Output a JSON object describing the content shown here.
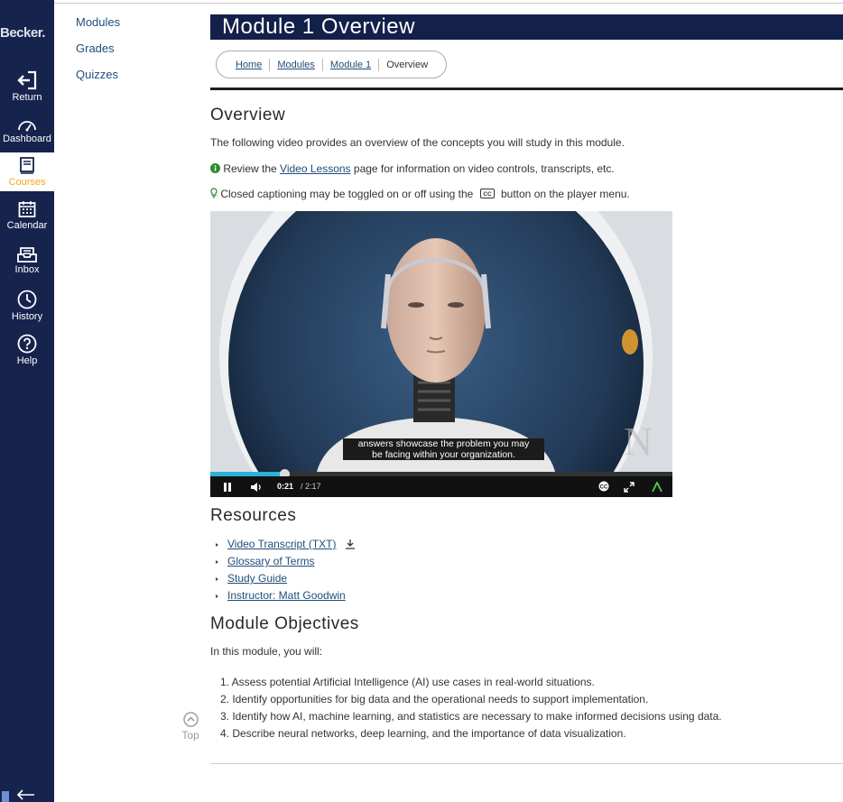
{
  "global_nav": {
    "logo": "Becker.",
    "items": [
      {
        "label": "Return",
        "icon": "return-icon"
      },
      {
        "label": "Dashboard",
        "icon": "dashboard-icon"
      },
      {
        "label": "Courses",
        "icon": "courses-icon",
        "active": true
      },
      {
        "label": "Calendar",
        "icon": "calendar-icon"
      },
      {
        "label": "Inbox",
        "icon": "inbox-icon"
      },
      {
        "label": "History",
        "icon": "history-icon"
      },
      {
        "label": "Help",
        "icon": "help-icon"
      }
    ]
  },
  "course_nav": {
    "items": [
      "Modules",
      "Grades",
      "Quizzes"
    ]
  },
  "header": {
    "title": "Module 1 Overview"
  },
  "breadcrumb": {
    "home": "Home",
    "modules": "Modules",
    "module1": "Module 1",
    "current": "Overview"
  },
  "overview": {
    "heading": "Overview",
    "intro": "The following video provides an overview of the concepts you will study in this module.",
    "review_pre": "Review the ",
    "review_link": "Video Lessons",
    "review_post": " page for information on video controls, transcripts, etc.",
    "cc_pre": "Closed captioning may be toggled on or off using the ",
    "cc_post": " button on the player menu."
  },
  "video": {
    "caption_line1": "answers showcase the problem you may",
    "caption_line2": "be facing within your organization.",
    "current_time": "0:21",
    "duration": "/ 2:17",
    "progress": 0.16,
    "watermark": "N"
  },
  "resources": {
    "heading": "Resources",
    "items": [
      "Video Transcript (TXT)",
      "Glossary of Terms",
      "Study Guide",
      "Instructor: Matt Goodwin"
    ]
  },
  "objectives": {
    "heading": "Module Objectives",
    "intro": "In this module, you will:",
    "items": [
      "1. Assess potential Artificial Intelligence (AI) use cases in real-world situations.",
      "2. Identify opportunities for big data and the operational needs to support implementation.",
      "3. Identify how AI, machine learning, and statistics are necessary to make informed decisions using data.",
      "4. Describe neural networks, deep learning, and the importance of data visualization."
    ]
  },
  "top_link": {
    "label": "Top"
  },
  "colors": {
    "nav_bg": "#16234d",
    "active": "#f0a81b",
    "link": "#1f4e79",
    "progress": "#2ab1d8"
  }
}
